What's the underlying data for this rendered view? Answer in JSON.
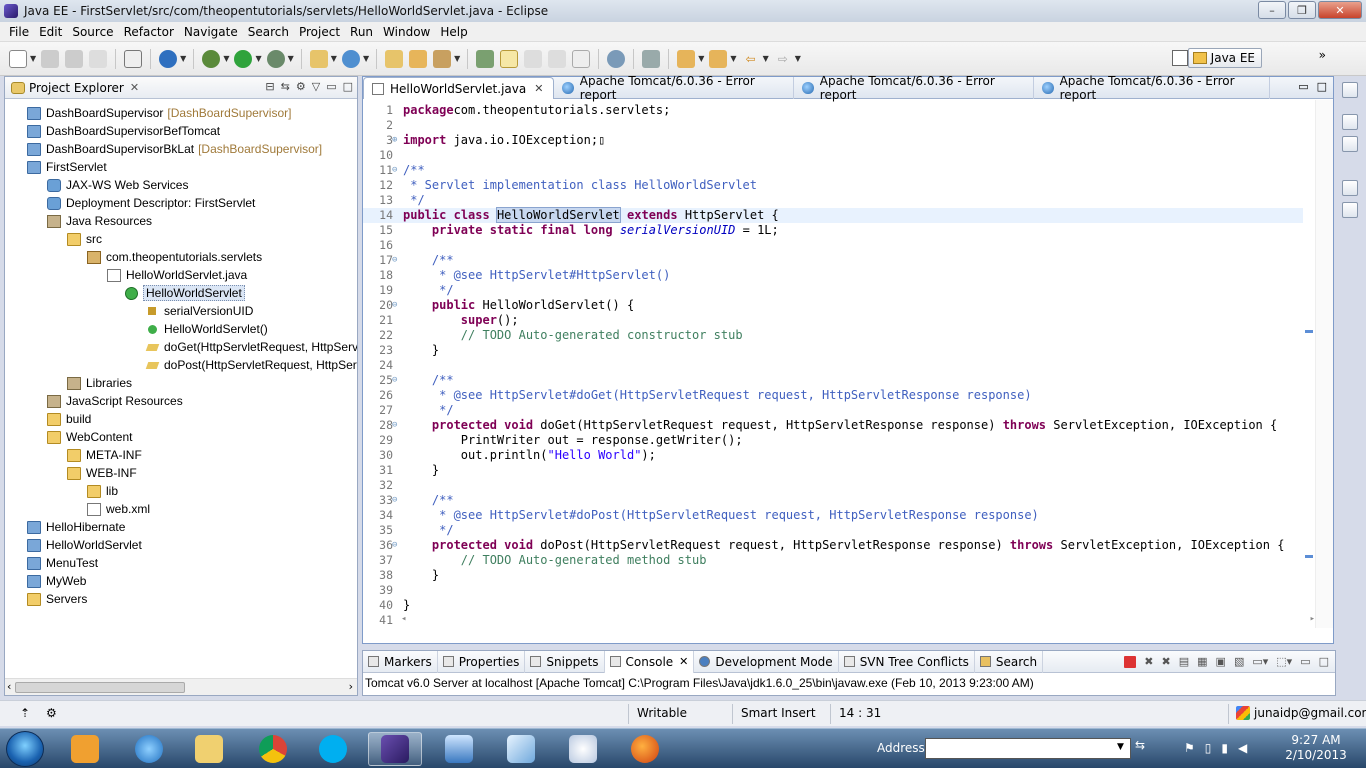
{
  "window": {
    "title": "Java EE - FirstServlet/src/com/theopentutorials/servlets/HelloWorldServlet.java - Eclipse",
    "minimize": "–",
    "maximize": "❐",
    "close": "✕"
  },
  "menubar": [
    "File",
    "Edit",
    "Source",
    "Refactor",
    "Navigate",
    "Search",
    "Project",
    "Run",
    "Window",
    "Help"
  ],
  "toolbar": {
    "perspective_label": "Java EE",
    "overflow": "»"
  },
  "explorer": {
    "title": "Project Explorer",
    "close": "✕",
    "tools": [
      "⊟",
      "⇆",
      "⚙",
      "▽",
      "□",
      "▭"
    ],
    "items": [
      {
        "label": "DashBoardSupervisor",
        "decor": "[DashBoardSupervisor]",
        "icon": "project-icon",
        "depth": 0
      },
      {
        "label": "DashBoardSupervisorBefTomcat",
        "decor": "",
        "icon": "project-icon",
        "depth": 0
      },
      {
        "label": "DashBoardSupervisorBkLat",
        "decor": "[DashBoardSupervisor]",
        "icon": "project-icon",
        "depth": 0
      },
      {
        "label": "FirstServlet",
        "decor": "",
        "icon": "project-icon",
        "depth": 0
      },
      {
        "label": "JAX-WS Web Services",
        "decor": "",
        "icon": "webservices-icon",
        "depth": 1
      },
      {
        "label": "Deployment Descriptor: FirstServlet",
        "decor": "",
        "icon": "descriptor-icon",
        "depth": 1
      },
      {
        "label": "Java Resources",
        "decor": "",
        "icon": "java-resources-icon",
        "depth": 1
      },
      {
        "label": "src",
        "decor": "",
        "icon": "source-folder-icon",
        "depth": 2
      },
      {
        "label": "com.theopentutorials.servlets",
        "decor": "",
        "icon": "package-icon",
        "depth": 3
      },
      {
        "label": "HelloWorldServlet.java",
        "decor": "",
        "icon": "java-file-icon",
        "depth": 4
      },
      {
        "label": "HelloWorldServlet",
        "decor": "",
        "icon": "class-icon",
        "depth": 5
      },
      {
        "label": "serialVersionUID",
        "decor": "",
        "icon": "field-icon",
        "depth": 6
      },
      {
        "label": "HelloWorldServlet()",
        "decor": "",
        "icon": "constructor-icon",
        "depth": 6
      },
      {
        "label": "doGet(HttpServletRequest, HttpServl",
        "decor": "",
        "icon": "method-icon",
        "depth": 6
      },
      {
        "label": "doPost(HttpServletRequest, HttpServ",
        "decor": "",
        "icon": "method-icon",
        "depth": 6
      },
      {
        "label": "Libraries",
        "decor": "",
        "icon": "library-icon",
        "depth": 2
      },
      {
        "label": "JavaScript Resources",
        "decor": "",
        "icon": "javascript-resources-icon",
        "depth": 1
      },
      {
        "label": "build",
        "decor": "",
        "icon": "folder-icon",
        "depth": 1
      },
      {
        "label": "WebContent",
        "decor": "",
        "icon": "folder-icon",
        "depth": 1
      },
      {
        "label": "META-INF",
        "decor": "",
        "icon": "folder-icon",
        "depth": 2
      },
      {
        "label": "WEB-INF",
        "decor": "",
        "icon": "folder-icon",
        "depth": 2
      },
      {
        "label": "lib",
        "decor": "",
        "icon": "folder-icon",
        "depth": 3
      },
      {
        "label": "web.xml",
        "decor": "",
        "icon": "xml-file-icon",
        "depth": 3
      },
      {
        "label": "HelloHibernate",
        "decor": "",
        "icon": "project-icon",
        "depth": 0
      },
      {
        "label": "HelloWorldServlet",
        "decor": "",
        "icon": "project-icon",
        "depth": 0
      },
      {
        "label": "MenuTest",
        "decor": "",
        "icon": "project-icon",
        "depth": 0
      },
      {
        "label": "MyWeb",
        "decor": "",
        "icon": "project-icon",
        "depth": 0
      },
      {
        "label": "Servers",
        "decor": "",
        "icon": "folder-icon",
        "depth": 0
      }
    ],
    "selected_index": 10,
    "scroll_left": "‹",
    "scroll_right": "›"
  },
  "editor": {
    "tabs": [
      {
        "label": "HelloWorldServlet.java",
        "icon": "java-file-icon",
        "active": true,
        "close": "✕"
      },
      {
        "label": "Apache Tomcat/6.0.36 - Error report",
        "icon": "globe-icon",
        "active": false,
        "close": ""
      },
      {
        "label": "Apache Tomcat/6.0.36 - Error report",
        "icon": "globe-icon",
        "active": false,
        "close": ""
      },
      {
        "label": "Apache Tomcat/6.0.36 - Error report",
        "icon": "globe-icon",
        "active": false,
        "close": ""
      }
    ],
    "minimize": "▭",
    "maximize": "□",
    "current_line": 14,
    "lines": [
      {
        "n": "1",
        "fold": "",
        "tokens": [
          [
            "kw",
            "package"
          ],
          [
            "",
            "com.theopentutorials.servlets;"
          ]
        ]
      },
      {
        "n": "2",
        "fold": "",
        "tokens": []
      },
      {
        "n": "3",
        "fold": "⊕",
        "tokens": [
          [
            "kw",
            "import"
          ],
          [
            "",
            " java.io.IOException;"
          ],
          [
            "",
            "▯"
          ]
        ]
      },
      {
        "n": "10",
        "fold": "",
        "tokens": []
      },
      {
        "n": "11",
        "fold": "⊖",
        "tokens": [
          [
            "jd",
            "/**"
          ]
        ]
      },
      {
        "n": "12",
        "fold": "",
        "tokens": [
          [
            "jd",
            " * Servlet implementation class HelloWorldServlet"
          ]
        ]
      },
      {
        "n": "13",
        "fold": "",
        "tokens": [
          [
            "jd",
            " */"
          ]
        ]
      },
      {
        "n": "14",
        "fold": "",
        "tokens": [
          [
            "kw",
            "public"
          ],
          [
            "",
            " "
          ],
          [
            "kw",
            "class"
          ],
          [
            "",
            " "
          ],
          [
            "hl",
            "HelloWorldServlet"
          ],
          [
            "",
            " "
          ],
          [
            "kw",
            "extends"
          ],
          [
            "",
            " HttpServlet {"
          ]
        ]
      },
      {
        "n": "15",
        "fold": "",
        "tokens": [
          [
            "",
            "    "
          ],
          [
            "kw",
            "private"
          ],
          [
            "",
            " "
          ],
          [
            "kw",
            "static"
          ],
          [
            "",
            " "
          ],
          [
            "kw",
            "final"
          ],
          [
            "",
            " "
          ],
          [
            "kw",
            "long"
          ],
          [
            "",
            " "
          ],
          [
            "fi",
            "serialVersionUID"
          ],
          [
            "",
            " = 1L;"
          ]
        ]
      },
      {
        "n": "16",
        "fold": "",
        "tokens": []
      },
      {
        "n": "17",
        "fold": "⊖",
        "tokens": [
          [
            "",
            "    "
          ],
          [
            "jd",
            "/**"
          ]
        ]
      },
      {
        "n": "18",
        "fold": "",
        "tokens": [
          [
            "",
            "    "
          ],
          [
            "jd",
            " * @see HttpServlet#HttpServlet()"
          ]
        ]
      },
      {
        "n": "19",
        "fold": "",
        "tokens": [
          [
            "",
            "    "
          ],
          [
            "jd",
            " */"
          ]
        ]
      },
      {
        "n": "20",
        "fold": "⊖",
        "tokens": [
          [
            "",
            "    "
          ],
          [
            "kw",
            "public"
          ],
          [
            "",
            " HelloWorldServlet() {"
          ]
        ]
      },
      {
        "n": "21",
        "fold": "",
        "tokens": [
          [
            "",
            "        "
          ],
          [
            "kw",
            "super"
          ],
          [
            "",
            "();"
          ]
        ]
      },
      {
        "n": "22",
        "fold": "",
        "tokens": [
          [
            "",
            "        "
          ],
          [
            "cm",
            "// TODO Auto-generated constructor stub"
          ]
        ]
      },
      {
        "n": "23",
        "fold": "",
        "tokens": [
          [
            "",
            "    }"
          ]
        ]
      },
      {
        "n": "24",
        "fold": "",
        "tokens": []
      },
      {
        "n": "25",
        "fold": "⊖",
        "tokens": [
          [
            "",
            "    "
          ],
          [
            "jd",
            "/**"
          ]
        ]
      },
      {
        "n": "26",
        "fold": "",
        "tokens": [
          [
            "",
            "    "
          ],
          [
            "jd",
            " * @see HttpServlet#doGet(HttpServletRequest request, HttpServletResponse response)"
          ]
        ]
      },
      {
        "n": "27",
        "fold": "",
        "tokens": [
          [
            "",
            "    "
          ],
          [
            "jd",
            " */"
          ]
        ]
      },
      {
        "n": "28",
        "fold": "⊖",
        "tokens": [
          [
            "",
            "    "
          ],
          [
            "kw",
            "protected"
          ],
          [
            "",
            " "
          ],
          [
            "kw",
            "void"
          ],
          [
            "",
            " doGet(HttpServletRequest request, HttpServletResponse response) "
          ],
          [
            "kw",
            "throws"
          ],
          [
            "",
            " ServletException, IOException {"
          ]
        ]
      },
      {
        "n": "29",
        "fold": "",
        "tokens": [
          [
            "",
            "        PrintWriter out = response.getWriter();"
          ]
        ]
      },
      {
        "n": "30",
        "fold": "",
        "tokens": [
          [
            "",
            "        out.println("
          ],
          [
            "st",
            "\"Hello World\""
          ],
          [
            "",
            ");"
          ]
        ]
      },
      {
        "n": "31",
        "fold": "",
        "tokens": [
          [
            "",
            "    }"
          ]
        ]
      },
      {
        "n": "32",
        "fold": "",
        "tokens": []
      },
      {
        "n": "33",
        "fold": "⊖",
        "tokens": [
          [
            "",
            "    "
          ],
          [
            "jd",
            "/**"
          ]
        ]
      },
      {
        "n": "34",
        "fold": "",
        "tokens": [
          [
            "",
            "    "
          ],
          [
            "jd",
            " * @see HttpServlet#doPost(HttpServletRequest request, HttpServletResponse response)"
          ]
        ]
      },
      {
        "n": "35",
        "fold": "",
        "tokens": [
          [
            "",
            "    "
          ],
          [
            "jd",
            " */"
          ]
        ]
      },
      {
        "n": "36",
        "fold": "⊖",
        "tokens": [
          [
            "",
            "    "
          ],
          [
            "kw",
            "protected"
          ],
          [
            "",
            " "
          ],
          [
            "kw",
            "void"
          ],
          [
            "",
            " doPost(HttpServletRequest request, HttpServletResponse response) "
          ],
          [
            "kw",
            "throws"
          ],
          [
            "",
            " ServletException, IOException {"
          ]
        ]
      },
      {
        "n": "37",
        "fold": "",
        "tokens": [
          [
            "",
            "        "
          ],
          [
            "cm",
            "// TODO Auto-generated method stub"
          ]
        ]
      },
      {
        "n": "38",
        "fold": "",
        "tokens": [
          [
            "",
            "    }"
          ]
        ]
      },
      {
        "n": "39",
        "fold": "",
        "tokens": []
      },
      {
        "n": "40",
        "fold": "",
        "tokens": [
          [
            "",
            "}"
          ]
        ]
      },
      {
        "n": "41",
        "fold": "",
        "tokens": []
      }
    ],
    "scroll_left": "◂",
    "scroll_right": "▸"
  },
  "console": {
    "tabs": [
      {
        "label": "Markers",
        "active": false
      },
      {
        "label": "Properties",
        "active": false
      },
      {
        "label": "Snippets",
        "active": false
      },
      {
        "label": "Console",
        "active": true,
        "close": "✕"
      },
      {
        "label": "Development Mode",
        "active": false
      },
      {
        "label": "SVN Tree Conflicts",
        "active": false
      },
      {
        "label": "Search",
        "active": false
      }
    ],
    "text": "Tomcat v6.0 Server at localhost [Apache Tomcat] C:\\Program Files\\Java\\jdk1.6.0_25\\bin\\javaw.exe (Feb 10, 2013 9:23:00 AM)"
  },
  "statusbar": {
    "writable": "Writable",
    "insert_mode": "Smart Insert",
    "position": "14 : 31",
    "user": "junaidp@gmail.com"
  },
  "taskbar": {
    "address_label": "Address",
    "address_value": "",
    "clock_time": "9:27 AM",
    "clock_date": "2/10/2013"
  },
  "colors": {
    "keyword": "#7f0055",
    "comment": "#3f7f5f",
    "javadoc": "#3f5fbf",
    "string": "#2a00ff",
    "field": "#0000c0",
    "selection": "#c8d8f0"
  }
}
